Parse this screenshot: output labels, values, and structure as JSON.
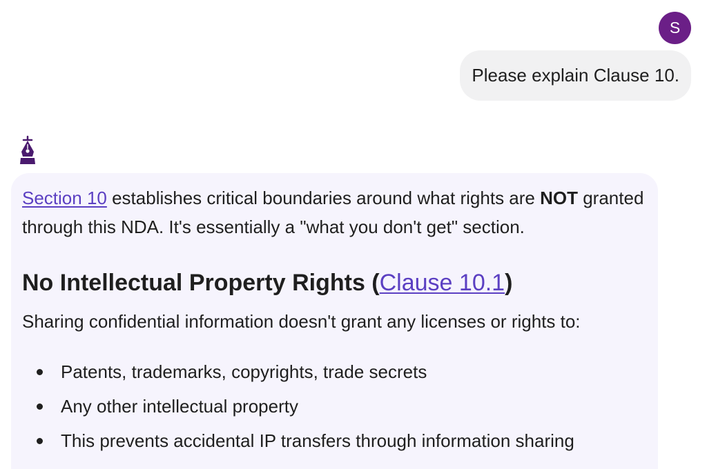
{
  "user": {
    "avatar_initial": "S",
    "message": "Please explain Clause 10."
  },
  "assistant": {
    "icon": "fountain-pen-icon",
    "para": {
      "link": "Section 10",
      "text1": " establishes critical boundaries around what rights are ",
      "bold": "NOT",
      "text2": " granted through this NDA. It's essentially a \"what you don't get\" section."
    },
    "heading": {
      "text": "No Intellectual Property Rights (",
      "link": "Clause 10.1",
      "close": ")"
    },
    "intro": "Sharing confidential information doesn't grant any licenses or rights to:",
    "bullets": [
      "Patents, trademarks, copyrights, trade secrets",
      "Any other intellectual property",
      "This prevents accidental IP transfers through information sharing"
    ]
  },
  "colors": {
    "avatar": "#6b1f87",
    "user_bubble": "#f1f1f2",
    "assistant_card": "#f6f4fd",
    "link": "#5b3fc2",
    "icon": "#4a1a6e"
  }
}
